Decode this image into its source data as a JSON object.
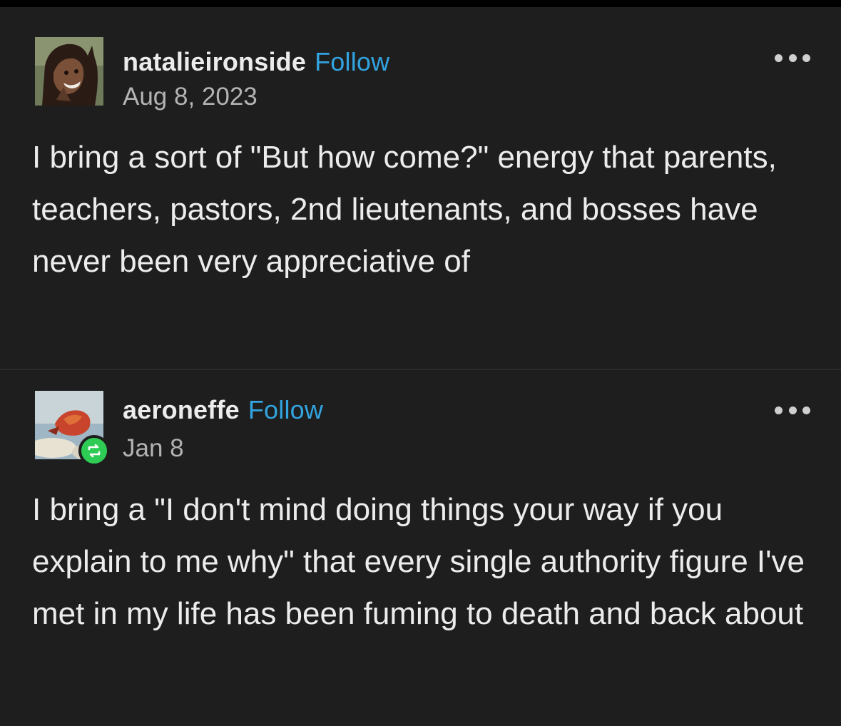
{
  "posts": [
    {
      "username": "natalieironside",
      "follow_label": "Follow",
      "date": "Aug 8, 2023",
      "body": "I bring a sort of \"But how come?\" energy that parents, teachers, pastors, 2nd lieutenants, and bosses have never been very appreciative of",
      "avatar_icon": "character-portrait-avatar",
      "more_icon": "ellipsis-icon"
    },
    {
      "username": "aeroneffe",
      "follow_label": "Follow",
      "date": "Jan 8",
      "body": "I bring a \"I don't mind doing things your way if you explain to me why\" that every single authority figure I've met in my life has been fuming to death and back about",
      "avatar_icon": "artwork-avatar",
      "badge_icon": "reblog-icon",
      "more_icon": "ellipsis-icon"
    }
  ],
  "colors": {
    "background": "#1e1e1e",
    "follow_link": "#32a4e0",
    "reblog_badge": "#2ecc54",
    "date_text": "#b3b3b3"
  }
}
